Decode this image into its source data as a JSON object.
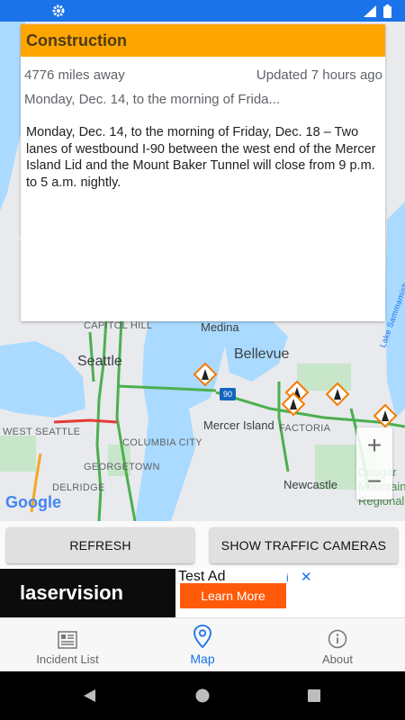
{
  "status_bar": {
    "icons": [
      "gear-icon",
      "signal-icon",
      "battery-icon"
    ]
  },
  "popup": {
    "category": "Construction",
    "distance": "4776 miles away",
    "updated": "Updated 7 hours ago",
    "summary": "Monday, Dec. 14, to the morning of Frida...",
    "description": "Monday, Dec. 14, to the morning of Friday, Dec. 18 – Two lanes of westbound I-90 between the west end of the Mercer Island Lid and the Mount Baker Tunnel will close from 9 p.m. to 5 a.m. nightly."
  },
  "map": {
    "labels": {
      "capitol_hill": "CAPITOL HILL",
      "medina": "Medina",
      "seattle": "Seattle",
      "bellevue": "Bellevue",
      "west_seattle": "WEST SEATTLE",
      "columbia_city": "COLUMBIA CITY",
      "mercer_island": "Mercer Island",
      "factoria": "FACTORIA",
      "georgetown": "GEORGETOWN",
      "delridge": "DELRIDGE",
      "newcastle": "Newcastle",
      "lake_sammamish": "Lake Sammamish",
      "cougar_mountain": "Cougar Mountain Regional",
      "shield_i90": "90"
    },
    "attribution": "Google",
    "zoom_in": "+",
    "zoom_out": "−",
    "colors": {
      "water": "#aadaff",
      "land": "#e8eaed",
      "park": "#c8e6c9",
      "traffic_green": "#4caf50",
      "traffic_red": "#e53935",
      "traffic_orange": "#f5a623"
    }
  },
  "buttons": {
    "refresh": "REFRESH",
    "traffic_cameras": "SHOW TRAFFIC CAMERAS"
  },
  "ad": {
    "brand": "laservision",
    "tag": "Test Ad",
    "cta": "Learn More",
    "info": "i",
    "close": "✕"
  },
  "nav": {
    "items": [
      {
        "label": "Incident List",
        "icon": "list-icon"
      },
      {
        "label": "Map",
        "icon": "map-pin-icon"
      },
      {
        "label": "About",
        "icon": "info-icon"
      }
    ],
    "active_index": 1,
    "accent": "#1a73e8"
  },
  "system_nav": {
    "icons": [
      "back-icon",
      "home-icon",
      "recents-icon"
    ]
  }
}
